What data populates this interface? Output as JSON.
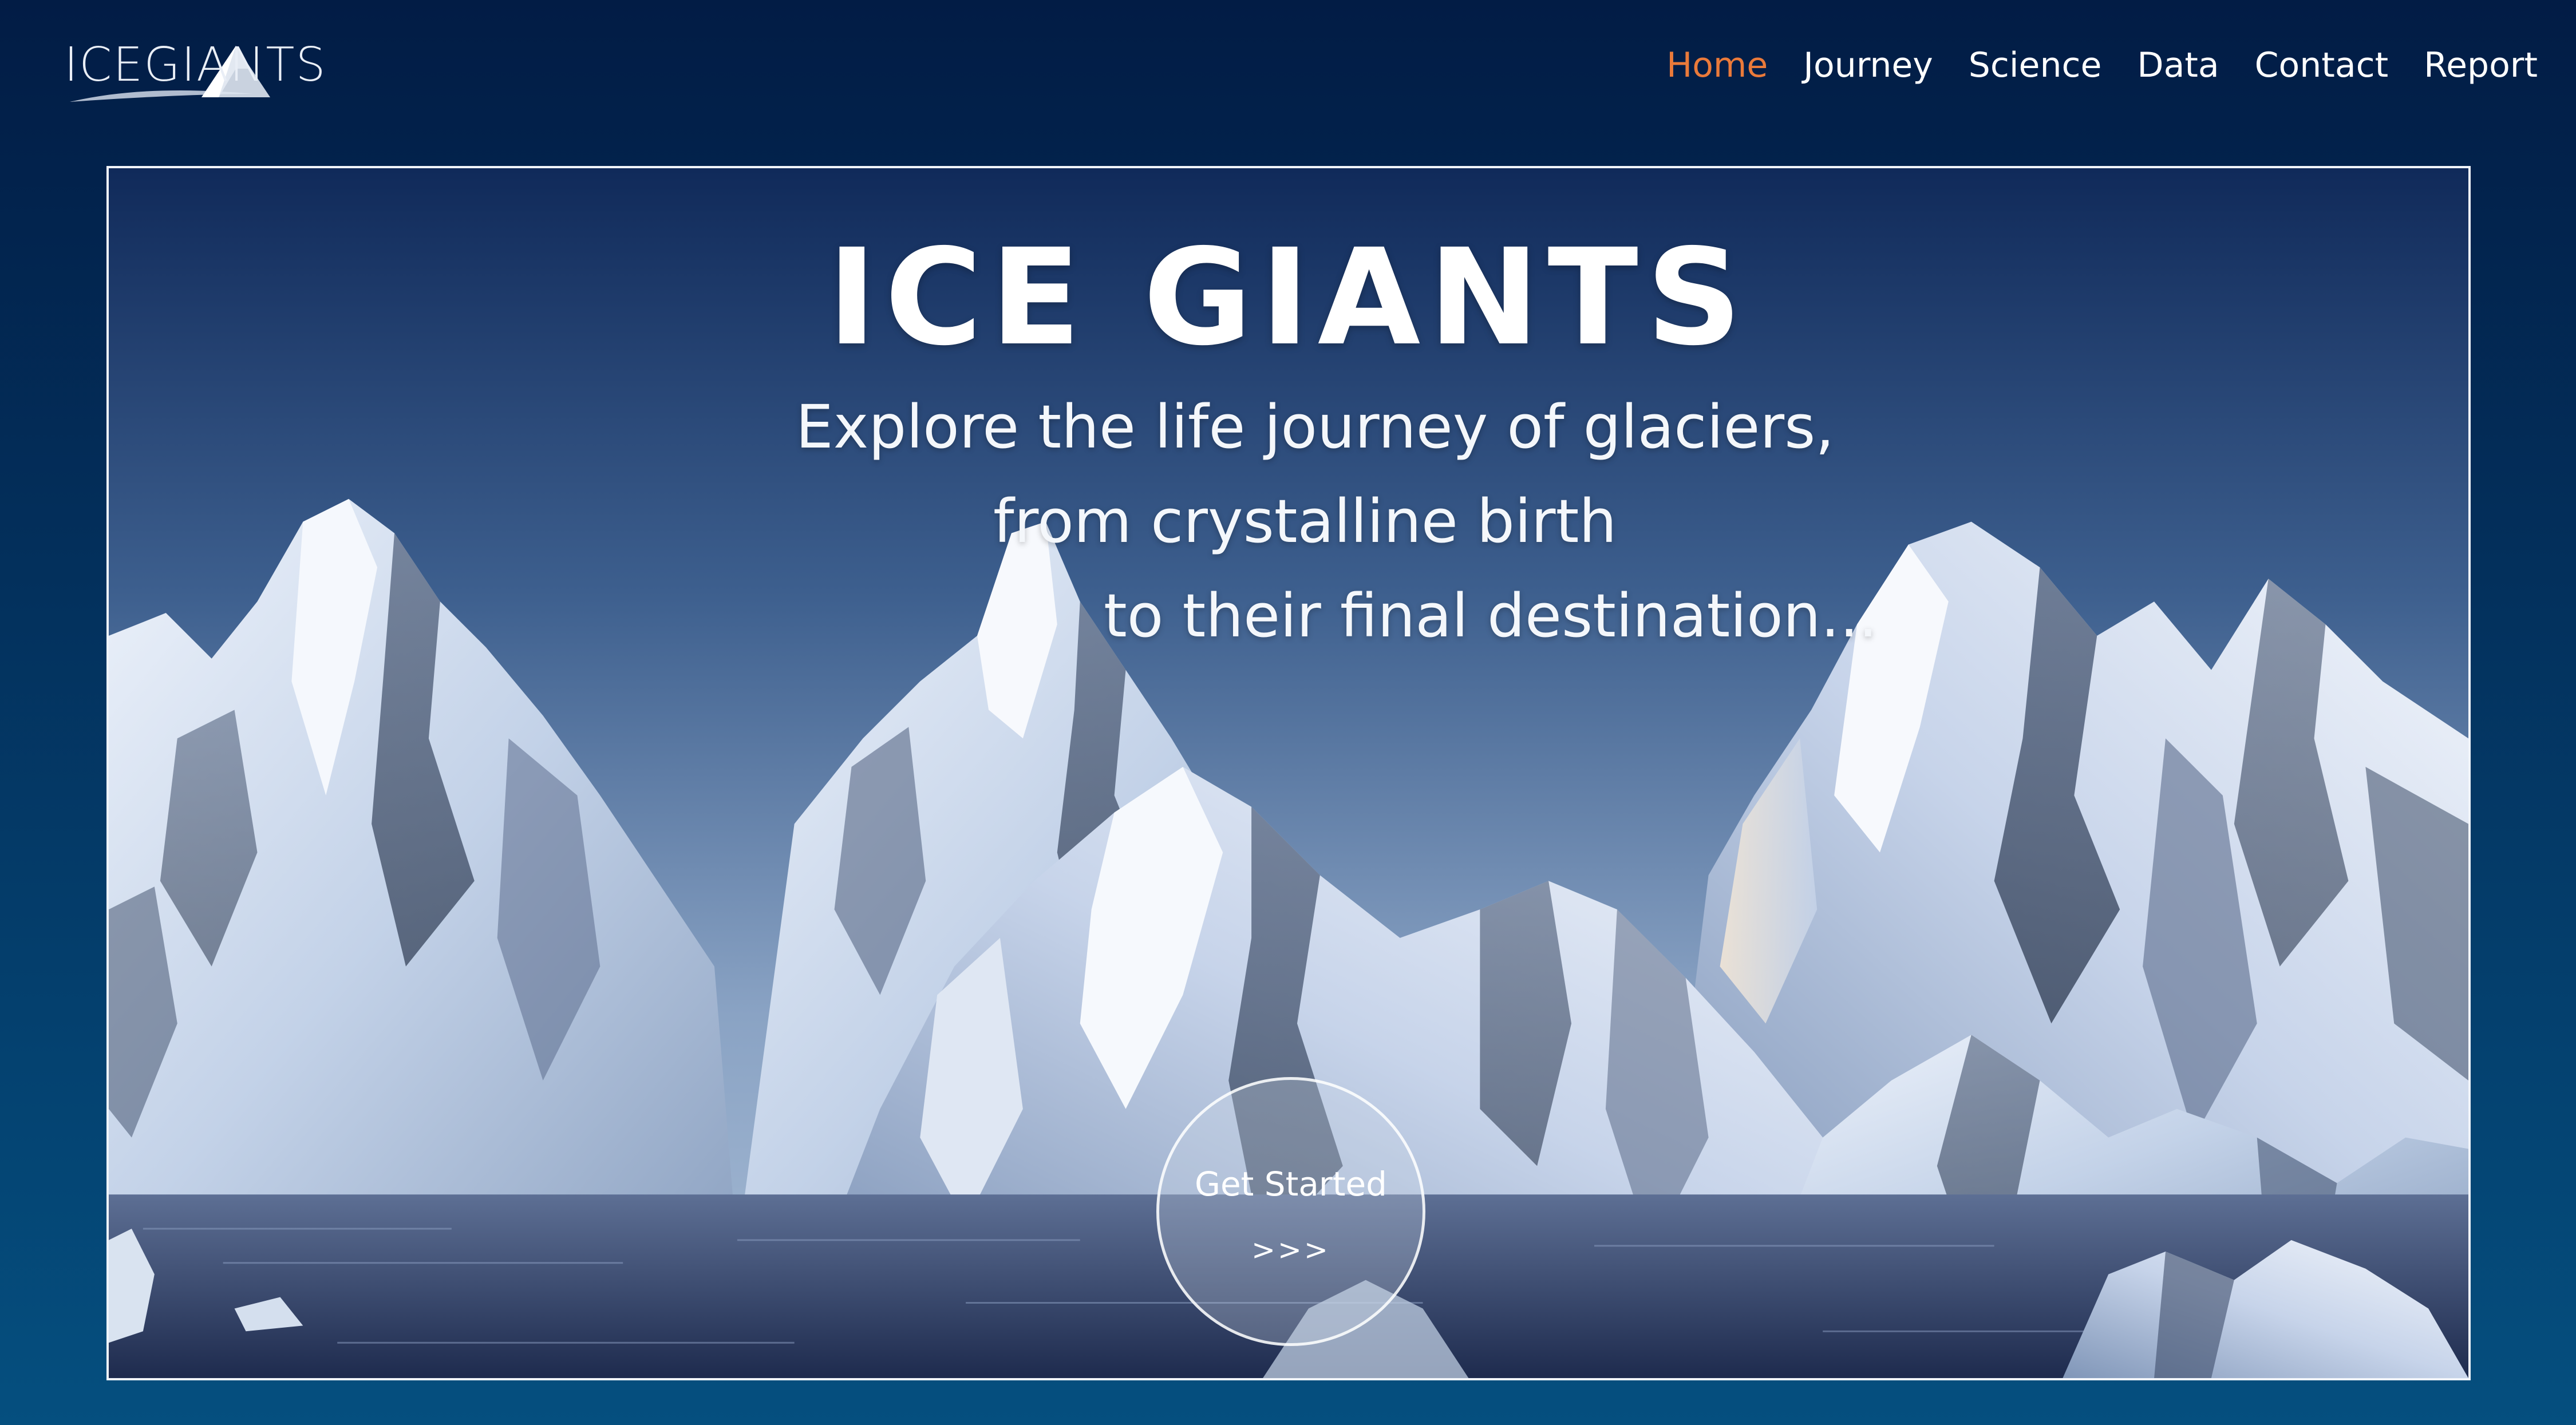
{
  "header": {
    "logo_text": "ICEGIANTS",
    "nav": [
      {
        "label": "Home",
        "active": true
      },
      {
        "label": "Journey",
        "active": false
      },
      {
        "label": "Science",
        "active": false
      },
      {
        "label": "Data",
        "active": false
      },
      {
        "label": "Contact",
        "active": false
      },
      {
        "label": "Report",
        "active": false
      }
    ]
  },
  "hero": {
    "title": "ICE GIANTS",
    "subtitle_lines": [
      "Explore the life journey of glaciers,",
      "from crystalline birth",
      "to their final destination..."
    ],
    "cta_label": "Get Started",
    "cta_arrows": ">>>"
  },
  "colors": {
    "background_top": "#021c45",
    "background_bottom": "#054f7f",
    "nav_active": "#ea7a3a",
    "nav_text": "#ffffff",
    "hero_border": "#f0f4fa"
  },
  "icons": {
    "logo_peak": "mountain-peak-icon"
  }
}
